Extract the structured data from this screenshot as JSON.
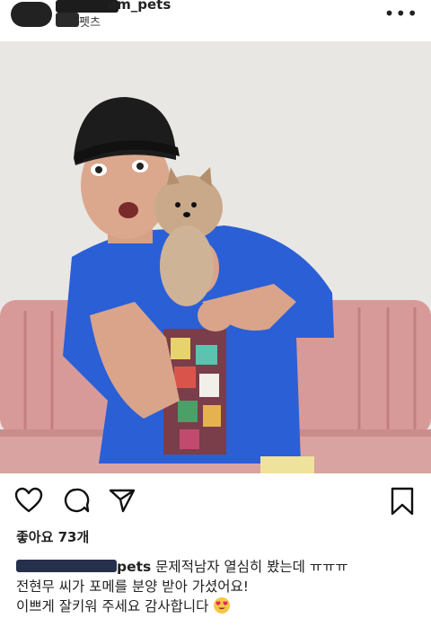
{
  "post": {
    "username_visible": "am_pets",
    "subtitle_visible": "펫츠",
    "more_label": "•••"
  },
  "actions": {
    "icons": [
      "heart-icon",
      "comment-icon",
      "share-icon",
      "bookmark-icon"
    ]
  },
  "likes": {
    "text": "좋아요 73개"
  },
  "caption": {
    "user_visible": "pets",
    "line1": " 문제적남자 열심히 봤는데 ㅠㅠㅠ",
    "line2": "전현무 씨가 포메를 분양 받아 가셨어요!",
    "line3": "이쁘게 잘키워 주세요 감사합니다 ",
    "emoji": "heart-eyes-emoji"
  }
}
